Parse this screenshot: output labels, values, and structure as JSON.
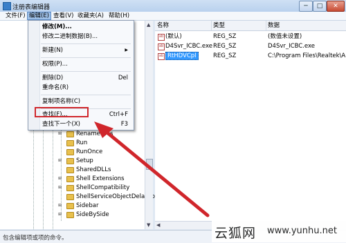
{
  "window": {
    "title": "注册表编辑器",
    "controls": {
      "minimize": "─",
      "maximize": "□",
      "close": "✕"
    }
  },
  "menubar": {
    "items": [
      {
        "label": "文件(F)",
        "active": false
      },
      {
        "label": "编辑(E)",
        "active": true
      },
      {
        "label": "查看(V)",
        "active": false
      },
      {
        "label": "收藏夹(A)",
        "active": false
      },
      {
        "label": "帮助(H)",
        "active": false
      }
    ]
  },
  "edit_menu": {
    "items": [
      {
        "label": "修改(M)...",
        "shortcut": "",
        "bold": true
      },
      {
        "label": "修改二进制数据(B)...",
        "shortcut": ""
      },
      {
        "label": "新建(N)",
        "shortcut": "",
        "submenu": true
      },
      {
        "label": "权限(P)...",
        "shortcut": ""
      },
      {
        "label": "删除(D)",
        "shortcut": "Del"
      },
      {
        "label": "重命名(R)",
        "shortcut": ""
      },
      {
        "label": "复制项名称(C)",
        "shortcut": ""
      },
      {
        "label": "查找(F)...",
        "shortcut": "Ctrl+F",
        "highlighted": true
      },
      {
        "label": "查找下一个(X)",
        "shortcut": "F3"
      }
    ]
  },
  "tree": {
    "items": [
      {
        "label": "RenameFiles"
      },
      {
        "label": "Run"
      },
      {
        "label": "RunOnce"
      },
      {
        "label": "Setup"
      },
      {
        "label": "SharedDLLs"
      },
      {
        "label": "Shell Extensions"
      },
      {
        "label": "ShellCompatibility"
      },
      {
        "label": "ShellServiceObjectDelayLo"
      },
      {
        "label": "Sidebar"
      },
      {
        "label": "SideBySide"
      }
    ]
  },
  "values_list": {
    "columns": {
      "name": "名称",
      "type": "类型",
      "data": "数据"
    },
    "rows": [
      {
        "name": "(默认)",
        "type": "REG_SZ",
        "data": "(数值未设置)",
        "selected": false
      },
      {
        "name": "D4Svr_ICBC.exe",
        "type": "REG_SZ",
        "data": "D4Svr_ICBC.exe",
        "selected": false
      },
      {
        "name": "RtHDVCpl",
        "type": "REG_SZ",
        "data": "C:\\Program Files\\Realtek\\Au",
        "selected": true
      }
    ]
  },
  "statusbar": {
    "text": "包含编辑项或项的命令。"
  },
  "icons": {
    "value_icon": "ab",
    "expander": "⊞",
    "scroll_up": "▲",
    "scroll_down": "▼",
    "scroll_left": "◀",
    "submenu": "▶"
  },
  "watermark": {
    "cn": "云狐网",
    "url": "www.yunhu.net"
  },
  "colors": {
    "highlight_box": "#d0262b",
    "arrow": "#d0262b",
    "selection": "#3399ff"
  }
}
